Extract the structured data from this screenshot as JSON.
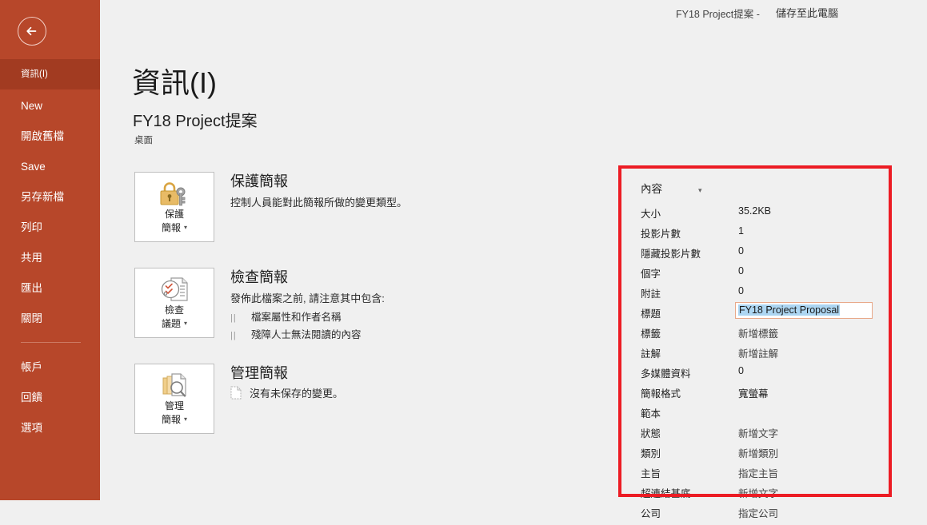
{
  "window": {
    "doc_title_bar": "FY18 Project提案 -",
    "save_location": "儲存至此電腦"
  },
  "sidebar": {
    "back_icon": "back-arrow-icon",
    "accent_color": "#b7472a",
    "selected_color": "#a23b21",
    "items": [
      {
        "label": "資訊(I)",
        "selected": true
      },
      {
        "label": "New",
        "selected": false
      },
      {
        "label": "開啟舊檔",
        "selected": false
      },
      {
        "label": "Save",
        "selected": false
      },
      {
        "label": "另存新檔",
        "selected": false
      },
      {
        "label": "列印",
        "selected": false
      },
      {
        "label": "共用",
        "selected": false
      },
      {
        "label": "匯出",
        "selected": false
      },
      {
        "label": "關閉",
        "selected": false
      }
    ],
    "bottom_items": [
      {
        "label": "帳戶"
      },
      {
        "label": "回饋"
      },
      {
        "label": "選項"
      }
    ]
  },
  "main": {
    "page_title": "資訊(I)",
    "doc_name": "FY18 Project提案",
    "doc_path": "桌面",
    "commands": [
      {
        "tile_line1": "保護",
        "tile_line2": "簡報",
        "tile_caret": "▾",
        "icon": "lock-key-icon",
        "heading": "保護簡報",
        "desc": "控制人員能對此簡報所做的變更類型。",
        "bullets": []
      },
      {
        "tile_line1": "檢查",
        "tile_line2": "議題",
        "tile_caret": "▾",
        "icon": "inspect-document-icon",
        "heading": "檢查簡報",
        "desc": "發佈此檔案之前, 請注意其中包含:",
        "bullets": [
          "檔案屬性和作者名稱",
          "殘障人士無法閱讀的內容"
        ]
      },
      {
        "tile_line1": "管理",
        "tile_line2": "簡報",
        "tile_caret": "▾",
        "icon": "manage-versions-icon",
        "heading": "管理簡報",
        "desc": "",
        "status": "沒有未保存的變更。",
        "status_icon": "document-icon",
        "bullets": []
      }
    ]
  },
  "properties": {
    "header": "內容",
    "header_caret": "▾",
    "highlight_color": "#ec1c24",
    "rows": [
      {
        "label": "大小",
        "value": "35.2KB",
        "type": "text"
      },
      {
        "label": "投影片數",
        "value": "1",
        "type": "text"
      },
      {
        "label": "隱藏投影片數",
        "value": "0",
        "type": "text"
      },
      {
        "label": "個字",
        "value": "0",
        "type": "text"
      },
      {
        "label": "附註",
        "value": "0",
        "type": "text"
      },
      {
        "label": "標題",
        "value": "FY18 Project Proposal",
        "type": "input-selected"
      },
      {
        "label": "標籤",
        "value": "新增標籤",
        "type": "placeholder"
      },
      {
        "label": "註解",
        "value": "新增註解",
        "type": "placeholder"
      },
      {
        "label": "多媒體資料",
        "value": "0",
        "type": "text"
      },
      {
        "label": "簡報格式",
        "value": "寬螢幕",
        "type": "text"
      },
      {
        "label": "範本",
        "value": "",
        "type": "text"
      },
      {
        "label": "狀態",
        "value": "新增文字",
        "type": "placeholder"
      },
      {
        "label": "類別",
        "value": "新增類別",
        "type": "placeholder"
      },
      {
        "label": "主旨",
        "value": "指定主旨",
        "type": "placeholder"
      },
      {
        "label": "超連結基底",
        "value": "新增文字",
        "type": "placeholder"
      },
      {
        "label": "公司",
        "value": "指定公司",
        "type": "placeholder"
      }
    ]
  }
}
